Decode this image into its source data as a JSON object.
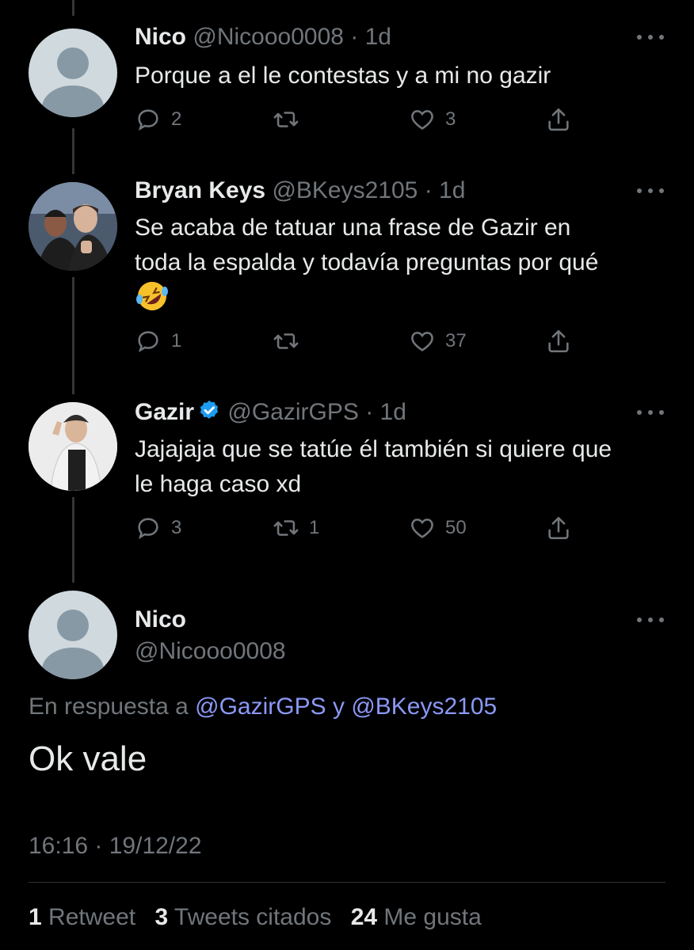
{
  "tweets": [
    {
      "name": "Nico",
      "handle": "@Nicooo0008",
      "separator": "·",
      "time": "1d",
      "text": "Porque a el le contestas y a mi no gazir",
      "replies": "2",
      "retweets": "",
      "likes": "3"
    },
    {
      "name": "Bryan Keys",
      "handle": "@BKeys2105",
      "separator": "·",
      "time": "1d",
      "text_line1": "Se acaba de tatuar una frase de Gazir en",
      "text_line2": "toda la espalda y todavía preguntas por qué",
      "emoji": "rolling-on-floor-laughing-emoji",
      "replies": "1",
      "retweets": "",
      "likes": "37"
    },
    {
      "name": "Gazir",
      "verified": true,
      "handle": "@GazirGPS",
      "separator": "·",
      "time": "1d",
      "text_line1": "Jajajaja que se tatúe él también si quiere que",
      "text_line2": "le haga caso xd",
      "replies": "3",
      "retweets": "1",
      "likes": "50"
    }
  ],
  "main_tweet": {
    "name": "Nico",
    "handle": "@Nicooo0008",
    "reply_prefix": "En respuesta a",
    "mention1": "@GazirGPS",
    "conjunction": "y",
    "mention2": "@BKeys2105",
    "text": "Ok vale",
    "timestamp": "16:16 · 19/12/22",
    "stats": {
      "retweets_count": "1",
      "retweets_label": "Retweet",
      "quotes_count": "3",
      "quotes_label": "Tweets citados",
      "likes_count": "24",
      "likes_label": "Me gusta"
    }
  },
  "colors": {
    "background": "#000000",
    "text": "#e7e9ea",
    "muted": "#71767b",
    "link": "#8b98f5",
    "verified": "#1d9bf0"
  }
}
